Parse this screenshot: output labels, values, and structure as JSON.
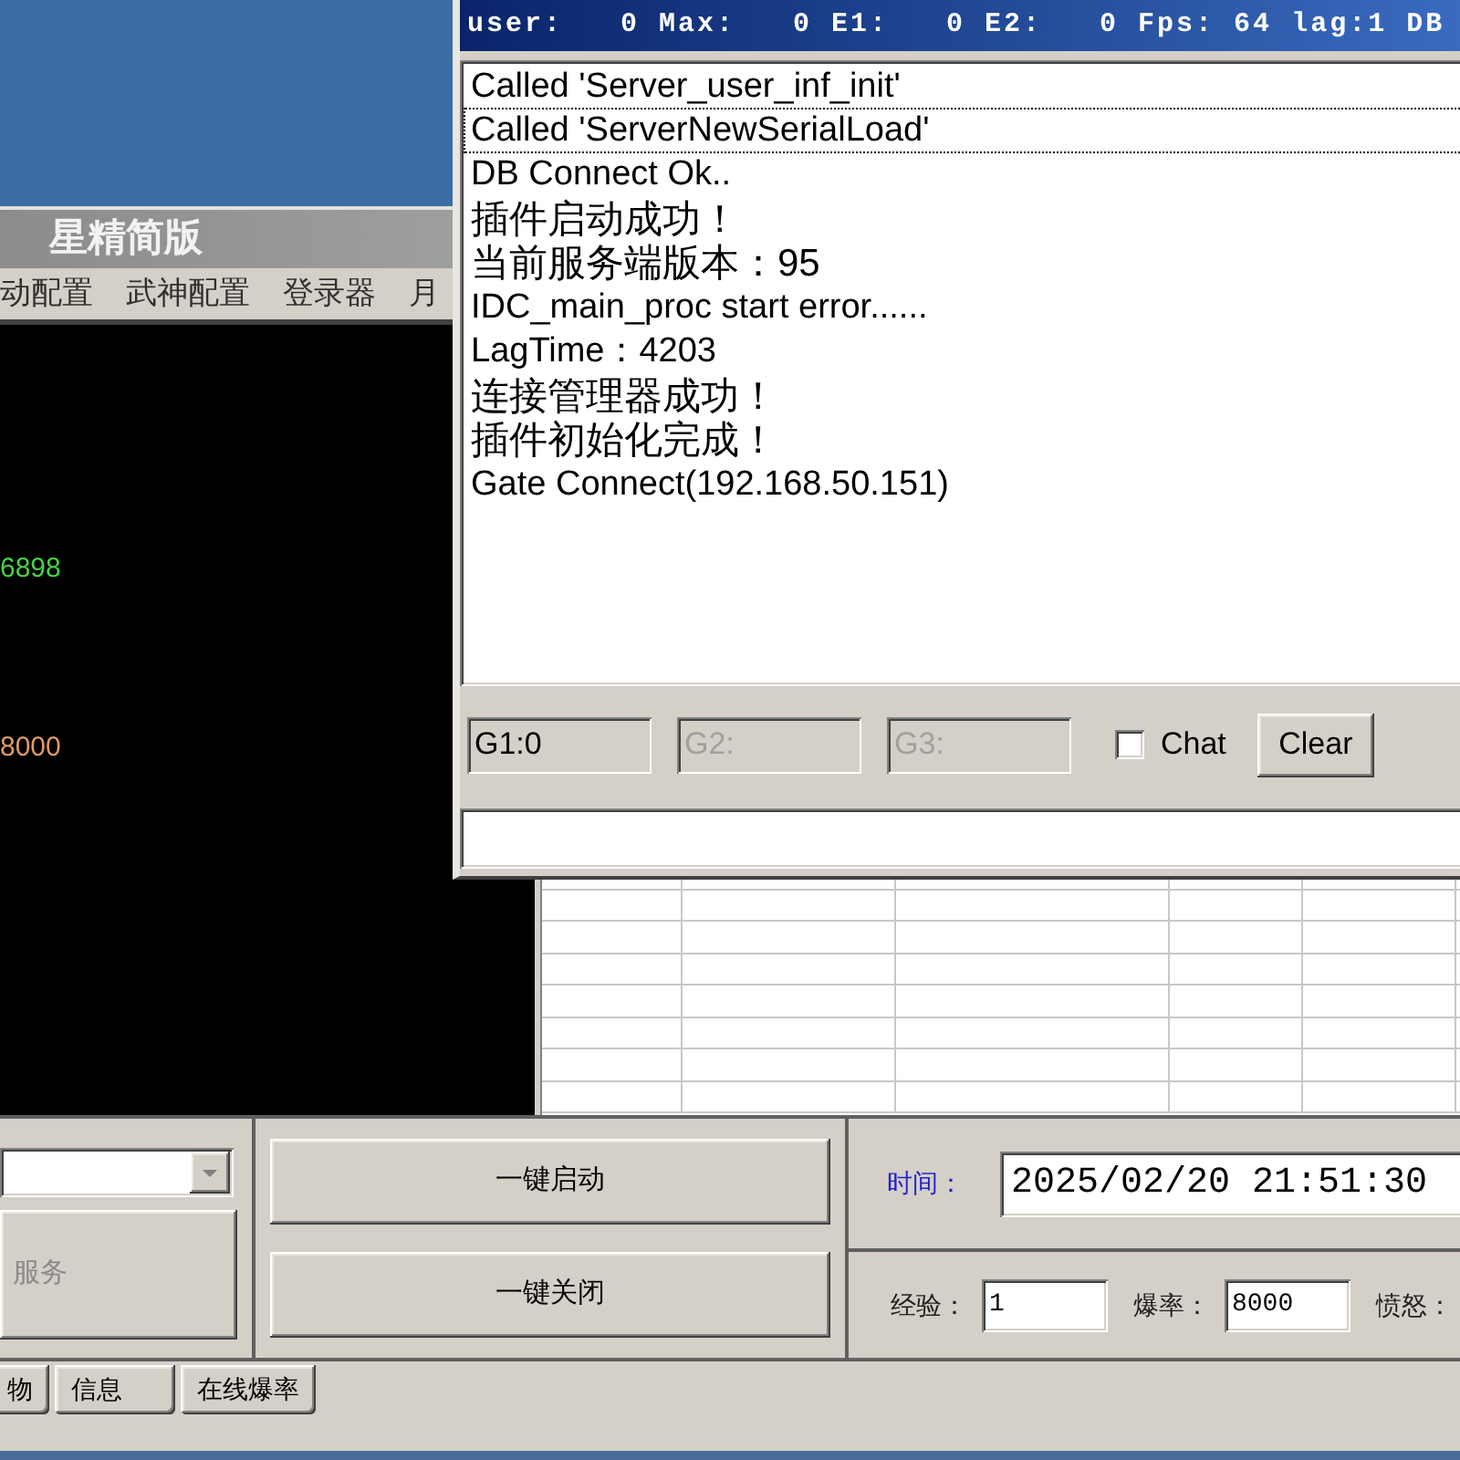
{
  "back_window": {
    "title": "星精简版",
    "menu": [
      "动配置",
      "武神配置",
      "登录器",
      "月"
    ],
    "console_lines": [
      {
        "text": "6898",
        "color": "#46d246"
      },
      {
        "text": "8000",
        "color": "#e29a68"
      }
    ]
  },
  "front_window": {
    "status_text": "user:   0 Max:   0 E1:   0 E2:   0 Fps: 64 lag:1 DB",
    "log": [
      {
        "text": "Called 'Server_user_inf_init'",
        "focused": false
      },
      {
        "text": "Called 'ServerNewSerialLoad'",
        "focused": true
      },
      {
        "text": "DB Connect Ok..",
        "focused": false
      },
      {
        "text": "插件启动成功！",
        "focused": false
      },
      {
        "text": "当前服务端版本：95",
        "focused": false
      },
      {
        "text": "IDC_main_proc start error......",
        "focused": false
      },
      {
        "text": "LagTime：4203",
        "focused": false
      },
      {
        "text": "连接管理器成功！",
        "focused": false
      },
      {
        "text": "插件初始化完成！",
        "focused": false
      },
      {
        "text": "Gate Connect(192.168.50.151)",
        "focused": false
      }
    ],
    "gate_fields": [
      {
        "value": "G1:0",
        "disabled": false
      },
      {
        "value": "G2:",
        "disabled": true
      },
      {
        "value": "G3:",
        "disabled": true
      }
    ],
    "chat": {
      "label": "Chat",
      "checked": false
    },
    "clear_button": "Clear"
  },
  "bottom_panel": {
    "service_button": {
      "label": "服务",
      "disabled": true
    },
    "actions": [
      "一键启动",
      "一键关闭"
    ],
    "time": {
      "label": "时间：",
      "value": "2025/02/20 21:51:30"
    },
    "rates": [
      {
        "label": "经验：",
        "value": "1"
      },
      {
        "label": "爆率：",
        "value": "8000"
      },
      {
        "label": "愤怒："
      }
    ]
  },
  "tabs": [
    "物",
    "信息",
    "在线爆率"
  ]
}
